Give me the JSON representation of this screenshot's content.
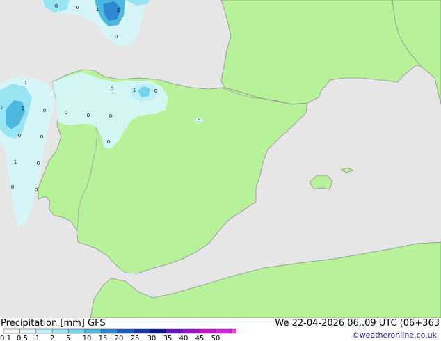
{
  "title": {
    "left": "Precipitation [mm] GFS",
    "right": "We 22-04-2026 06..09 UTC (06+363"
  },
  "credit": "©weatheronline.co.uk",
  "legend": {
    "labels": [
      "0.1",
      "0.5",
      "1",
      "2",
      "5",
      "10",
      "15",
      "20",
      "25",
      "30",
      "35",
      "40",
      "45",
      "50"
    ],
    "colors": [
      "#f8f8f8",
      "#dcf8fc",
      "#bdf0f8",
      "#98e4f2",
      "#74d4ec",
      "#4cb8e0",
      "#2c8ad0",
      "#1a5cc0",
      "#1a36a8",
      "#0c1890",
      "#6a10c8",
      "#a010d0",
      "#d010d0",
      "#e020e0",
      "#f040f0"
    ]
  },
  "colors": {
    "land": "#b7f29a",
    "sea": "#e6e6e6",
    "coast": "#8c8c8c",
    "border": "#a0a0a0"
  },
  "map_labels": [
    {
      "text": "0"
    },
    {
      "text": "0"
    },
    {
      "text": "1"
    },
    {
      "text": "2"
    },
    {
      "text": "0"
    },
    {
      "text": "1"
    },
    {
      "text": "1"
    },
    {
      "text": "2"
    },
    {
      "text": "0"
    },
    {
      "text": "0"
    },
    {
      "text": "0"
    },
    {
      "text": "0"
    },
    {
      "text": "1"
    },
    {
      "text": "0"
    },
    {
      "text": "0"
    },
    {
      "text": "0"
    },
    {
      "text": "0"
    },
    {
      "text": "0"
    },
    {
      "text": "0"
    },
    {
      "text": "1"
    },
    {
      "text": "0"
    },
    {
      "text": "0"
    }
  ]
}
